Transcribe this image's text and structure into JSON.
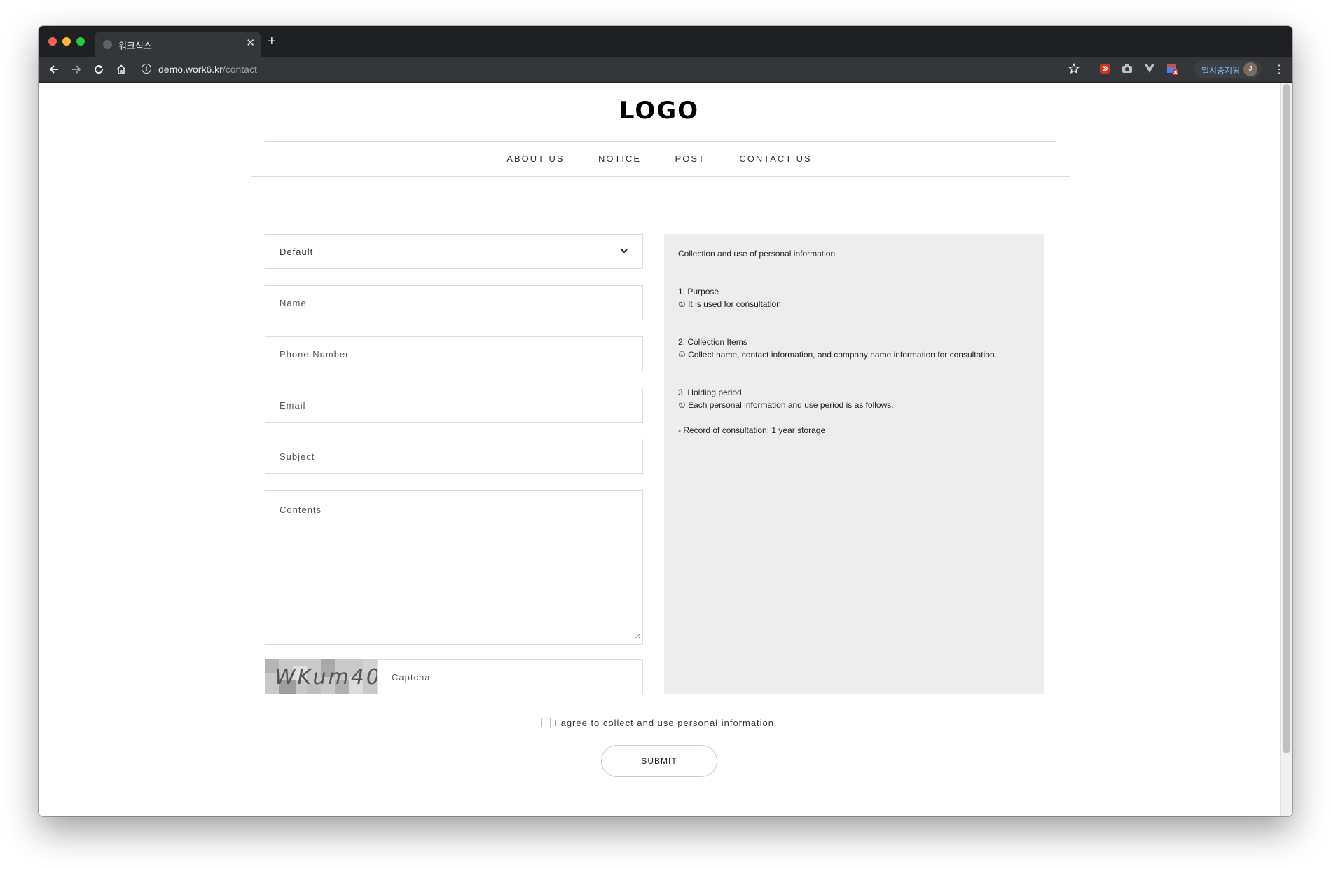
{
  "browser": {
    "tab_title": "워크식스",
    "url_host": "demo.work6.kr",
    "url_path": "/contact",
    "profile_label": "일시중지됨",
    "avatar_initial": "J"
  },
  "page": {
    "logo": "LOGO",
    "nav": [
      "ABOUT US",
      "NOTICE",
      "POST",
      "CONTACT US"
    ]
  },
  "form": {
    "select_value": "Default",
    "name_placeholder": "Name",
    "phone_placeholder": "Phone Number",
    "email_placeholder": "Email",
    "subject_placeholder": "Subject",
    "contents_placeholder": "Contents",
    "captcha_image_text": "WKum40",
    "captcha_placeholder": "Captcha",
    "agree_label": "I agree to collect and use personal information.",
    "submit_label": "SUBMIT"
  },
  "privacy": {
    "title": "Collection and use of personal information",
    "purpose_heading": "1. Purpose",
    "purpose_text": "① It is used for consultation.",
    "items_heading": "2. Collection Items",
    "items_text": "① Collect name, contact information, and company name information for consultation.",
    "period_heading": "3. Holding period",
    "period_text": "① Each personal information and use period is as follows.",
    "record_text": "- Record of consultation: 1 year storage"
  }
}
